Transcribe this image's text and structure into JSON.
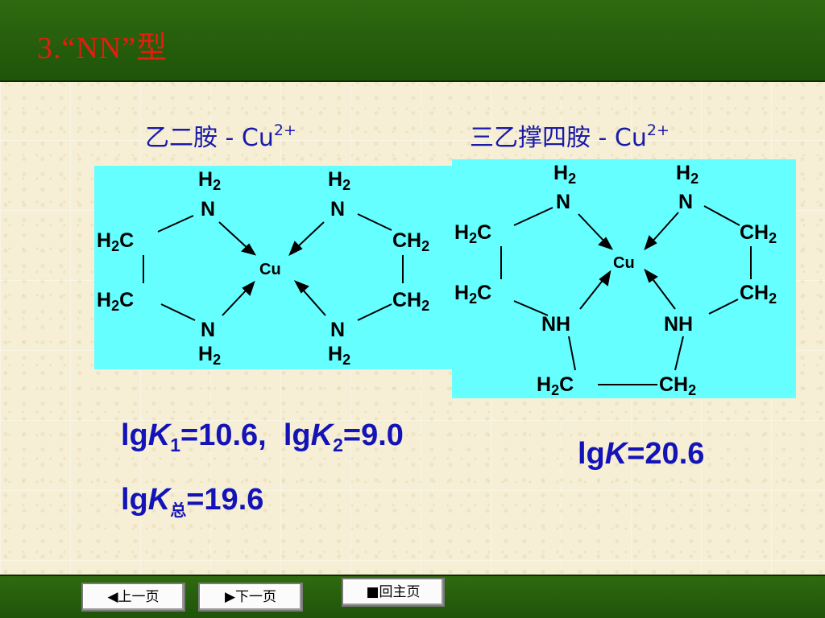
{
  "slide": {
    "title": "3.“NN”型"
  },
  "left_panel": {
    "caption_text": "乙二胺 - Cu",
    "caption_charge": "2+",
    "labels": {
      "h2_top_left": "H",
      "h2_top_left_sub": "2",
      "n_top_left": "N",
      "h2_top_right": "H",
      "h2_top_right_sub": "2",
      "n_top_right": "N",
      "h2c_upper": "H",
      "h2c_upper_sub": "2",
      "h2c_upper_c": "C",
      "h2c_lower": "H",
      "h2c_lower_sub": "2",
      "h2c_lower_c": "C",
      "ch2_upper": "CH",
      "ch2_upper_sub": "2",
      "ch2_lower": "CH",
      "ch2_lower_sub": "2",
      "cu": "Cu",
      "n_bottom_left": "N",
      "h2_bottom_left": "H",
      "h2_bottom_left_sub": "2",
      "n_bottom_right": "N",
      "h2_bottom_right": "H",
      "h2_bottom_right_sub": "2"
    },
    "eq_line1": {
      "p1": "lg",
      "k1": "K",
      "k1_sub": "1",
      "p2": "=10.6,  lg",
      "k2": "K",
      "k2_sub": "2",
      "p3": "=9.0"
    },
    "eq_line2": {
      "p1": "lg",
      "k": "K",
      "k_sub": "总",
      "p2": "=19.6"
    }
  },
  "right_panel": {
    "caption_text": "三乙撑四胺 - Cu",
    "caption_charge": "2+",
    "labels": {
      "h2_top_left": "H",
      "h2_top_left_sub": "2",
      "n_top_left": "N",
      "h2_top_right": "H",
      "h2_top_right_sub": "2",
      "n_top_right": "N",
      "h2c_upper": "H",
      "h2c_upper_sub": "2",
      "h2c_upper_c": "C",
      "h2c_lower": "H",
      "h2c_lower_sub": "2",
      "h2c_lower_c": "C",
      "ch2_upper": "CH",
      "ch2_upper_sub": "2",
      "ch2_lower": "CH",
      "ch2_lower_sub": "2",
      "cu": "Cu",
      "nh_left": "NH",
      "nh_right": "NH",
      "h2c_bottom": "H",
      "h2c_bottom_sub": "2",
      "h2c_bottom_c": "C",
      "ch2_bottom": "CH",
      "ch2_bottom_sub": "2"
    },
    "eq": {
      "p1": "lg",
      "k": "K",
      "p2": "=20.6"
    }
  },
  "nav": {
    "prev_label": "◀上一页",
    "next_label": "▶下一页",
    "home_label": "■回主页"
  },
  "colors": {
    "title_bar": "#2f6a10",
    "title_text": "#e21e10",
    "caption_text": "#1a1aa8",
    "equation_text": "#1313b8",
    "structure_box": "#66ffff",
    "background": "#f6efd6"
  }
}
